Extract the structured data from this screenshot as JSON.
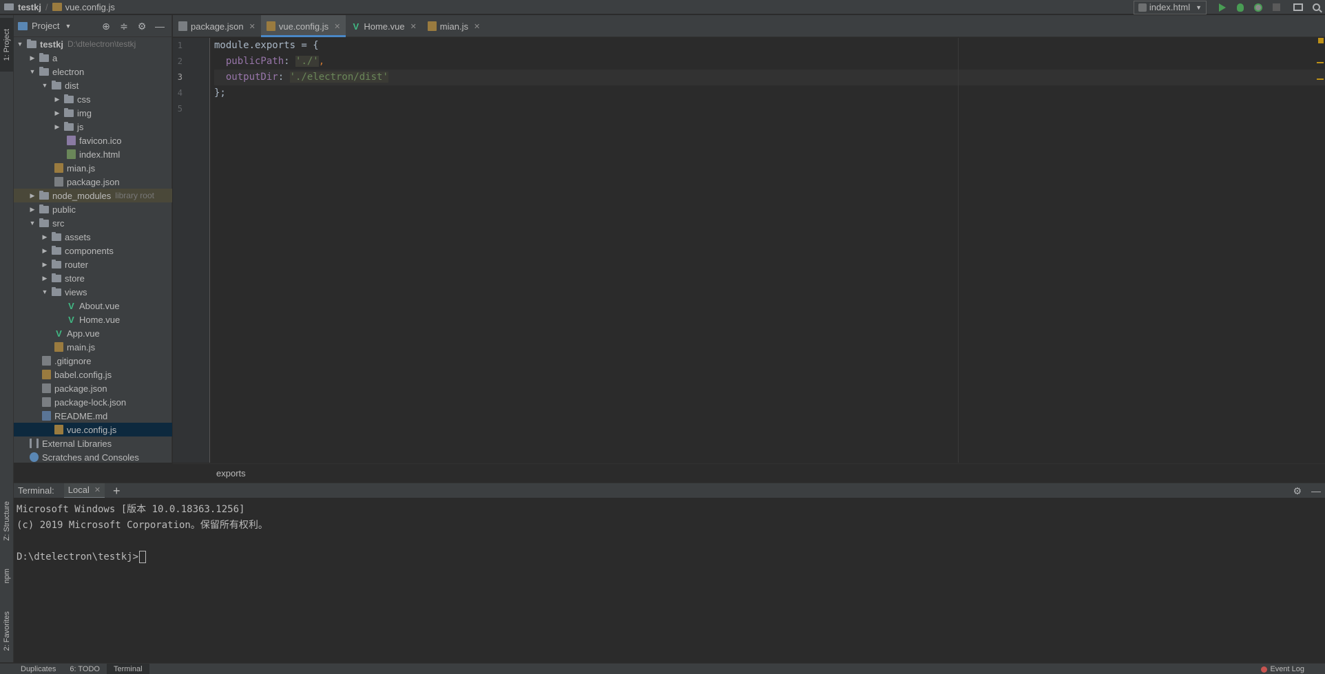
{
  "breadcrumb": {
    "project": "testkj",
    "file": "vue.config.js"
  },
  "run_config": {
    "label": "index.html"
  },
  "left_strip": {
    "project_tab": "1: Project",
    "structure_tab": "Z: Structure",
    "npm_tab": "npm",
    "favorites_tab": "2: Favorites"
  },
  "project_panel": {
    "title": "Project",
    "root_name": "testkj",
    "root_path": "D:\\dtelectron\\testkj",
    "items": [
      {
        "label": "a"
      },
      {
        "label": "electron"
      },
      {
        "label": "dist"
      },
      {
        "label": "css"
      },
      {
        "label": "img"
      },
      {
        "label": "js"
      },
      {
        "label": "favicon.ico"
      },
      {
        "label": "index.html"
      },
      {
        "label": "mian.js"
      },
      {
        "label": "package.json"
      },
      {
        "label": "node_modules",
        "hint": "library root"
      },
      {
        "label": "public"
      },
      {
        "label": "src"
      },
      {
        "label": "assets"
      },
      {
        "label": "components"
      },
      {
        "label": "router"
      },
      {
        "label": "store"
      },
      {
        "label": "views"
      },
      {
        "label": "About.vue"
      },
      {
        "label": "Home.vue"
      },
      {
        "label": "App.vue"
      },
      {
        "label": "main.js"
      },
      {
        "label": ".gitignore"
      },
      {
        "label": "babel.config.js"
      },
      {
        "label": "package.json"
      },
      {
        "label": "package-lock.json"
      },
      {
        "label": "README.md"
      },
      {
        "label": "vue.config.js"
      },
      {
        "label": "External Libraries"
      },
      {
        "label": "Scratches and Consoles"
      }
    ]
  },
  "editor_tabs": [
    {
      "label": "package.json"
    },
    {
      "label": "vue.config.js"
    },
    {
      "label": "Home.vue"
    },
    {
      "label": "mian.js"
    }
  ],
  "editor": {
    "line_numbers": [
      "1",
      "2",
      "3",
      "4",
      "5"
    ],
    "lines": {
      "l1_a": "module.exports = {",
      "l2_key": "publicPath",
      "l2_colon": ": ",
      "l2_val": "'./'",
      "l2_comma": ",",
      "l3_key": "outputDir",
      "l3_colon": ": ",
      "l3_val": "'./electron/dist'",
      "l4": "};"
    },
    "breadcrumb": "exports"
  },
  "terminal": {
    "label": "Terminal:",
    "tab": "Local",
    "lines": [
      "Microsoft Windows [版本 10.0.18363.1256]",
      "(c) 2019 Microsoft Corporation。保留所有权利。",
      "",
      "D:\\dtelectron\\testkj>"
    ]
  },
  "bottom_tabs": [
    "Duplicates",
    "6: TODO",
    "Terminal"
  ],
  "event_log": "Event Log"
}
